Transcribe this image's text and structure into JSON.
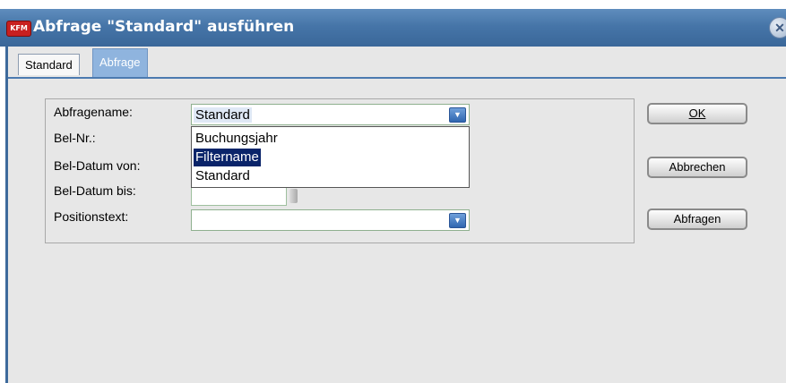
{
  "window": {
    "logo_text": "KFM",
    "title": "Abfrage \"Standard\" ausführen",
    "close_glyph": "✕"
  },
  "tabs": [
    {
      "label": "Standard",
      "active": false
    },
    {
      "label": "Abfrage",
      "active": true
    }
  ],
  "form": {
    "abfragename": {
      "label": "Abfragename:",
      "value": "Standard"
    },
    "belnr": {
      "label": "Bel-Nr.:",
      "value": ""
    },
    "beldatum_von": {
      "label": "Bel-Datum von:",
      "value": ""
    },
    "beldatum_bis": {
      "label": "Bel-Datum bis:",
      "value": ""
    },
    "positionstext": {
      "label": "Positionstext:",
      "value": ""
    }
  },
  "dropdown": {
    "options": [
      "Buchungsjahr",
      "Filtername",
      "Standard"
    ],
    "highlighted": "Filtername"
  },
  "buttons": {
    "ok": {
      "label": "OK",
      "mnemonic": "O"
    },
    "abbrechen": {
      "label": "Abbrechen",
      "mnemonic": "A"
    },
    "abfragen": {
      "label": "Abfragen",
      "mnemonic": "b"
    }
  },
  "colors": {
    "titlebar": "#4675a8",
    "highlight": "#0a246a",
    "active_tab": "#8fb4de",
    "dropdown_button": "#2f66b0"
  },
  "icons": {
    "app_logo": "kfm-logo-icon",
    "close": "close-icon",
    "dropdown": "chevron-down-icon",
    "spinner": "date-spinner-icon"
  }
}
